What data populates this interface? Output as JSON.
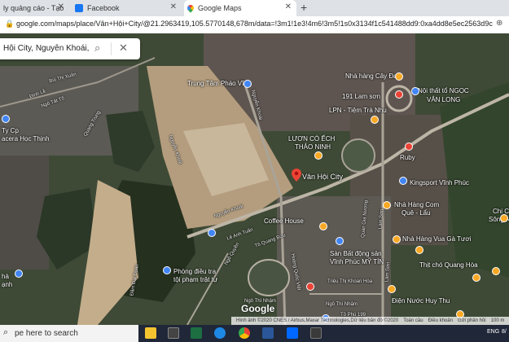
{
  "browser": {
    "tabs": [
      {
        "title": "ly quảng cáo - Tạo",
        "favicon": "ads-icon",
        "active": false
      },
      {
        "title": "Facebook",
        "favicon": "facebook-icon",
        "active": false
      },
      {
        "title": "Google Maps",
        "favicon": "maps-icon",
        "active": true
      }
    ],
    "new_tab": "+",
    "url": "google.com/maps/place/Vân+Hội+City/@21.2963419,105.5770148,678m/data=!3m1!1e3!4m6!3m5!1s0x3134f1c541488dd9:0xa4dd8e5ec2563d9c!4b1!8m2!3d"
  },
  "search": {
    "value": "Hội City, Nguyễn Khoái, Vĩnh",
    "search_icon": "magnifier-icon",
    "close_icon": "close-icon"
  },
  "map": {
    "selected_place": "Vân Hội City",
    "labels": {
      "trung_tam_phao_vu": "Trung Tâm Pháo Vĩ",
      "nha_hang_cay_da": "Nhà hàng Cây Đa",
      "191_lam_son": "191 Lam sơn",
      "noi_that": "Nội thất tổ NGỌC",
      "noi_that2": "VÂN LONG",
      "lpn": "LPN - Tiệm Trà Nhu",
      "luon_co_ech": "LƯƠN CÓ ẾCH",
      "thao_ninh": "THẢO NINH",
      "ruby": "Ruby",
      "kingsport": "Kingsport Vĩnh Phúc",
      "nha_hang_com_que": "Nhà Hàng Com",
      "nha_hang_com_que2": "Quê - Lẩu",
      "coffee_house": "Coffee House",
      "nha_hang_vua_ga": "Nhà Hàng Vua Gà Tươi",
      "san_bat_dong_san": "Sàn Bất động sản",
      "san_bat_dong_san2": "Vĩnh Phúc MỸ TÍN",
      "phong_dieu_tra": "Phòng điều tra",
      "phong_dieu_tra2": "tội phạm trật tự",
      "thit_cho": "Thịt chó Quang Hòa",
      "dien_nuoc": "Điện Nước Huy Thu",
      "chi_c": "Chi C",
      "song_n": "Sông N",
      "ha_thinh": "hà",
      "ha_thinh2": "ạnh",
      "ty_cp": "Ty Cp",
      "acera": "acera Học Thịnh",
      "bui_thi_xuan": "Bùi Thị Xuân",
      "dinh_le": "Đinh Lễ",
      "ngo_tat_to": "Ngô Tất Tố",
      "quang_trung": "Quang Trung",
      "nguyen_khoai": "Nguyễn Khoái",
      "le_anh_tuan": "Lê Anh Tuấn",
      "nguyen_khoai2": "Nguyễn Khoái",
      "dam_dai_doan": "Đầm Đại Đoàn",
      "nguyen_khoai3": "Nguyễn Khoái",
      "to_quang_buu": "Tô Quang Bửu",
      "hoang_quoc_viet": "Hoàng Quốc Việt",
      "ngo_thi_nham": "Ngô Thì Nhậm",
      "trieu_thi_khoan_hoa": "Triệu Thị Khoan Hòa",
      "ngo_thi_nham2": "Ngô Thì Nhậm",
      "lam_son": "Lam Sơn",
      "lam_son2": "Lam Sơn",
      "quan_gia_nuong": "Quán Gia Nương",
      "to_phu": "Tô Phú 199",
      "phe": "phe",
      "ngo_quyen": "Ngô Quyền"
    },
    "google_logo": "Google",
    "attribution": {
      "imagery": "Hình ảnh ©2020 CNES / Airbus,Maxar Technologies,Dữ liệu bản đồ ©2020",
      "terms": "Toàn cầu",
      "privacy": "Điều khoản",
      "feedback": "Gửi phản hồi",
      "scale": "100 m"
    }
  },
  "taskbar": {
    "search_placeholder": "pe here to search",
    "icons": [
      "file-explorer-icon",
      "store-icon",
      "excel-icon",
      "edge-icon",
      "chrome-icon",
      "word-icon",
      "zalo-icon",
      "app-icon"
    ],
    "tray": {
      "lang": "ENG",
      "time": "8/"
    }
  },
  "colors": {
    "accent": "#1a73e8",
    "pin_red": "#ea4335",
    "pin_orange": "#f9a825",
    "pin_blue": "#4285f4"
  }
}
